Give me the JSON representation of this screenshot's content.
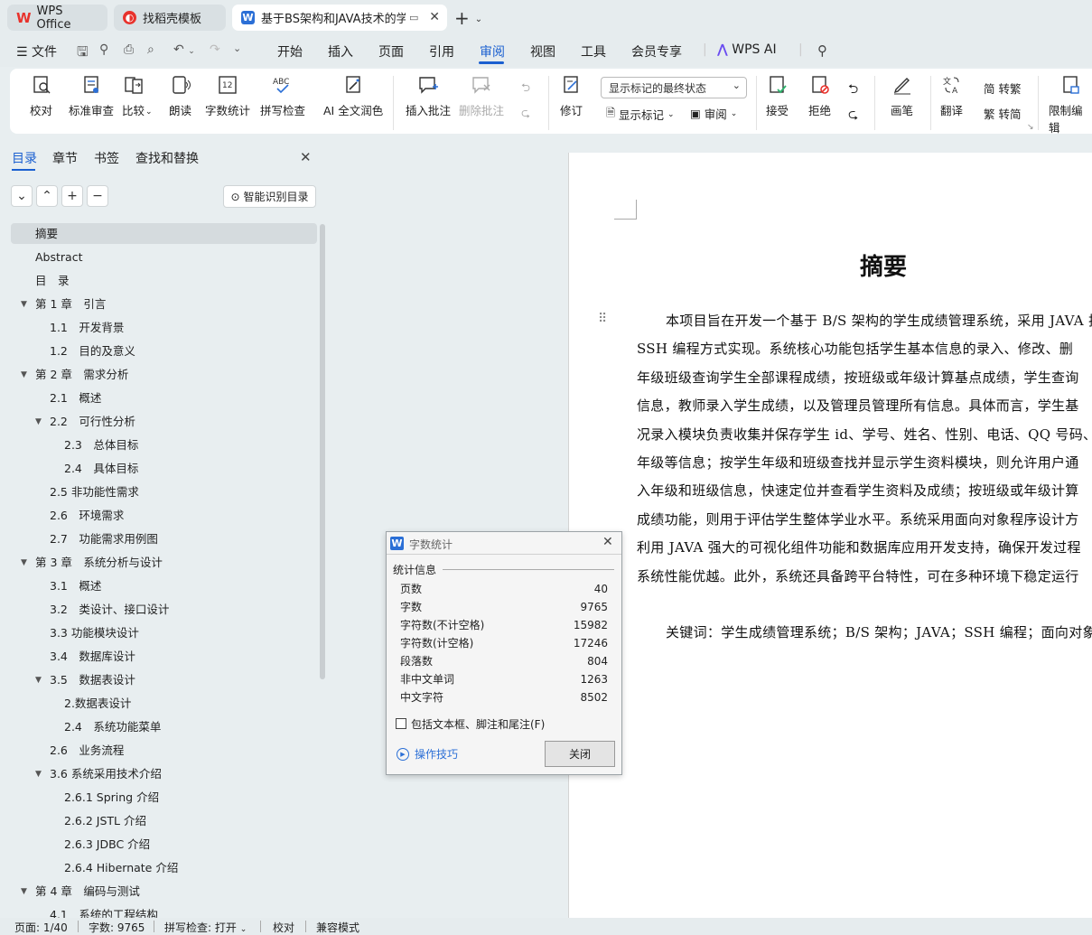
{
  "tabs": [
    {
      "label": "WPS Office",
      "icon": "wps-logo-icon"
    },
    {
      "label": "找稻壳模板",
      "icon": "docer-icon"
    },
    {
      "label": "基于BS架构和JAVA技术的学生",
      "icon": "writer-doc-icon"
    }
  ],
  "menu": {
    "file": "文件",
    "items": [
      "开始",
      "插入",
      "页面",
      "引用",
      "审阅",
      "视图",
      "工具",
      "会员专享"
    ],
    "active": "审阅",
    "wps_ai": "WPS AI"
  },
  "ribbon": {
    "proofread": "校对",
    "std_review": "标准审查",
    "compare": "比较",
    "read_aloud": "朗读",
    "word_count": "字数统计",
    "spell_check": "拼写检查",
    "ai_polish": "AI 全文润色",
    "insert_comment": "插入批注",
    "delete_comment": "删除批注",
    "track_changes": "修订",
    "display_state": "显示标记的最终状态",
    "show_markup": "显示标记",
    "review_pane": "审阅",
    "accept": "接受",
    "reject": "拒绝",
    "pen": "画笔",
    "translate": "翻译",
    "to_traditional": "转繁",
    "to_simplified": "转简",
    "restrict_edit": "限制编辑"
  },
  "sidebar": {
    "tabs": [
      "目录",
      "章节",
      "书签",
      "查找和替换"
    ],
    "smart_toc": "智能识别目录",
    "toc": [
      {
        "label": "摘要",
        "level": 0
      },
      {
        "label": "Abstract",
        "level": 0
      },
      {
        "label": "目　录",
        "level": 0
      },
      {
        "label": "第 1 章　引言",
        "level": 0,
        "collapsible": true
      },
      {
        "label": "1.1　开发背景",
        "level": 1
      },
      {
        "label": "1.2　目的及意义",
        "level": 1
      },
      {
        "label": "第 2 章　需求分析",
        "level": 0,
        "collapsible": true
      },
      {
        "label": "2.1　概述",
        "level": 1
      },
      {
        "label": "2.2　可行性分析",
        "level": 1,
        "collapsible": true
      },
      {
        "label": "2.3　总体目标",
        "level": 2
      },
      {
        "label": "2.4　具体目标",
        "level": 2
      },
      {
        "label": "2.5 非功能性需求",
        "level": 1
      },
      {
        "label": "2.6　环境需求",
        "level": 1
      },
      {
        "label": "2.7　功能需求用例图",
        "level": 1
      },
      {
        "label": "第 3 章　系统分析与设计",
        "level": 0,
        "collapsible": true
      },
      {
        "label": "3.1　概述",
        "level": 1
      },
      {
        "label": "3.2　类设计、接口设计",
        "level": 1
      },
      {
        "label": "3.3 功能模块设计",
        "level": 1
      },
      {
        "label": "3.4　数据库设计",
        "level": 1
      },
      {
        "label": "3.5　数据表设计",
        "level": 1,
        "collapsible": true
      },
      {
        "label": "2.数据表设计",
        "level": 2
      },
      {
        "label": "2.4　系统功能菜单",
        "level": 2
      },
      {
        "label": "2.6　业务流程",
        "level": 1
      },
      {
        "label": "3.6 系统采用技术介绍",
        "level": 1,
        "collapsible": true
      },
      {
        "label": "2.6.1 Spring 介绍",
        "level": 2
      },
      {
        "label": "2.6.2 JSTL 介绍",
        "level": 2
      },
      {
        "label": "2.6.3 JDBC 介绍",
        "level": 2
      },
      {
        "label": "2.6.4 Hibernate 介绍",
        "level": 2
      },
      {
        "label": "第 4 章　编码与测试",
        "level": 0,
        "collapsible": true
      },
      {
        "label": "4.1　系统的工程结构",
        "level": 1
      }
    ]
  },
  "document": {
    "title": "摘要",
    "lines": [
      "本项目旨在开发一个基于 B/S 架构的学生成绩管理系统，采用 JAVA 技",
      "SSH 编程方式实现。系统核心功能包括学生基本信息的录入、修改、删",
      "年级班级查询学生全部课程成绩，按班级或年级计算基点成绩，学生查询",
      "信息，教师录入学生成绩，以及管理员管理所有信息。具体而言，学生基",
      "况录入模块负责收集并保存学生 id、学号、姓名、性别、电话、QQ 号码、",
      "年级等信息；按学生年级和班级查找并显示学生资料模块，则允许用户通",
      "入年级和班级信息，快速定位并查看学生资料及成绩；按班级或年级计算",
      "成绩功能，则用于评估学生整体学业水平。系统采用面向对象程序设计方",
      "利用 JAVA 强大的可视化组件功能和数据库应用开发支持，确保开发过程",
      "系统性能优越。此外，系统还具备跨平台特性，可在多种环境下稳定运行"
    ],
    "keywords": "关键词：学生成绩管理系统；B/S 架构；JAVA；SSH 编程；面向对象"
  },
  "dialog": {
    "title": "字数统计",
    "section": "统计信息",
    "rows": [
      {
        "label": "页数",
        "value": "40"
      },
      {
        "label": "字数",
        "value": "9765"
      },
      {
        "label": "字符数(不计空格)",
        "value": "15982"
      },
      {
        "label": "字符数(计空格)",
        "value": "17246"
      },
      {
        "label": "段落数",
        "value": "804"
      },
      {
        "label": "非中文单词",
        "value": "1263"
      },
      {
        "label": "中文字符",
        "value": "8502"
      }
    ],
    "include_label": "包括文本框、脚注和尾注(F)",
    "tips": "操作技巧",
    "close": "关闭"
  },
  "status": {
    "page": "页面: 1/40",
    "words": "字数: 9765",
    "spell": "拼写检查: 打开",
    "proof": "校对",
    "compat": "兼容模式"
  },
  "colors": {
    "accent": "#1a5fd0",
    "wps_red": "#e8322c"
  }
}
